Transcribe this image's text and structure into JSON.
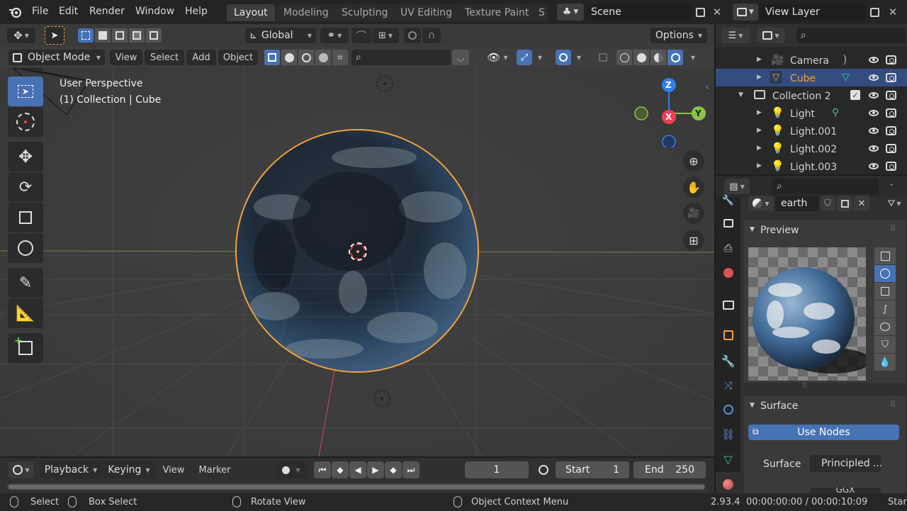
{
  "topbar": {
    "menus": [
      "File",
      "Edit",
      "Render",
      "Window",
      "Help"
    ],
    "workspaces": [
      "Layout",
      "Modeling",
      "Sculpting",
      "UV Editing",
      "Texture Paint",
      "S"
    ],
    "active_workspace": "Layout",
    "scene": "Scene",
    "view_layer": "View Layer"
  },
  "tool_header": {
    "orientation": "Global",
    "options": "Options"
  },
  "viewport_header": {
    "mode": "Object Mode",
    "menus": [
      "View",
      "Select",
      "Add",
      "Object"
    ]
  },
  "viewport": {
    "perspective": "User Perspective",
    "collection_info": "(1) Collection | Cube",
    "gizmo": {
      "x": "X",
      "y": "Y",
      "z": "Z"
    }
  },
  "outliner": {
    "rows": [
      {
        "label": "Camera",
        "icon": "camera-icon",
        "selected": false,
        "depth": 1
      },
      {
        "label": "Cube",
        "icon": "mesh-icon",
        "selected": true,
        "depth": 1
      },
      {
        "label": "Collection 2",
        "icon": "collection-icon",
        "selected": false,
        "depth": 0
      },
      {
        "label": "Light",
        "icon": "light-icon",
        "selected": false,
        "depth": 1
      },
      {
        "label": "Light.001",
        "icon": "light-icon",
        "selected": false,
        "depth": 1
      },
      {
        "label": "Light.002",
        "icon": "light-icon",
        "selected": false,
        "depth": 1
      },
      {
        "label": "Light.003",
        "icon": "light-icon",
        "selected": false,
        "depth": 1
      }
    ]
  },
  "properties": {
    "material_name": "earth",
    "preview_label": "Preview",
    "surface_label": "Surface",
    "use_nodes": "Use Nodes",
    "surface_field_label": "Surface",
    "surface_value": "Principled ...",
    "partial_text": "GGX"
  },
  "timeline": {
    "menus": [
      "Playback",
      "Keying",
      "View",
      "Marker"
    ],
    "current_frame": "1",
    "start_label": "Start",
    "start_value": "1",
    "end_label": "End",
    "end_value": "250"
  },
  "status": {
    "select": "Select",
    "box_select": "Box Select",
    "rotate_view": "Rotate View",
    "context_menu": "Object Context Menu",
    "version": "2.93.4",
    "time": "00:00:00:00 / 00:00:10:09",
    "partial": "Star"
  },
  "colors": {
    "accent": "#4772b3",
    "selection_outline": "#f5a13a",
    "x_axis": "#f53b57",
    "y_axis": "#8bc34a",
    "z_axis": "#2f80ed"
  }
}
